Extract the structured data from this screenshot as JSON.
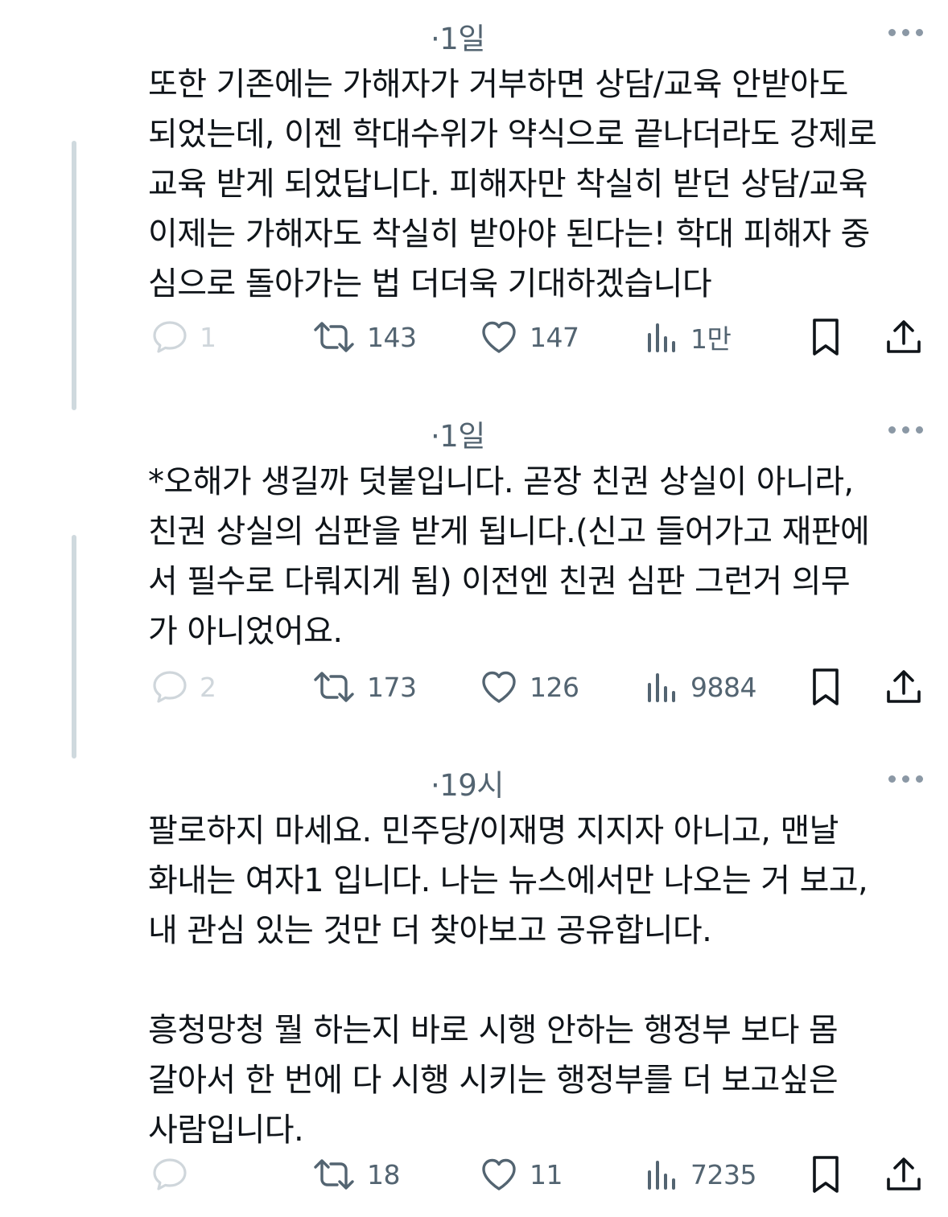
{
  "tweets": [
    {
      "time": "·1일",
      "text": "또한 기존에는 가해자가 거부하면 상담/교육 안받아도\n되었는데, 이젠 학대수위가 약식으로 끝나더라도 강제로\n교육 받게 되었답니다. 피해자만 착실히 받던 상담/교육\n이제는 가해자도 착실히 받아야 된다는! 학대 피해자 중\n심으로 돌아가는 법 더더욱 기대하겠습니다",
      "replies": "1",
      "retweets": "143",
      "likes": "147",
      "views": "1만"
    },
    {
      "time": "·1일",
      "text": "*오해가 생길까 덧붙입니다. 곧장 친권 상실이 아니라,\n친권 상실의 심판을 받게 됩니다.(신고 들어가고 재판에\n서 필수로 다뤄지게 됨) 이전엔 친권 심판 그런거 의무\n가 아니었어요.",
      "replies": "2",
      "retweets": "173",
      "likes": "126",
      "views": "9884"
    },
    {
      "time": "·19시",
      "text": "팔로하지 마세요. 민주당/이재명 지지자 아니고, 맨날\n화내는 여자1 입니다. 나는 뉴스에서만 나오는 거 보고,\n내 관심 있는 것만 더 찾아보고 공유합니다.\n\n흥청망청 뭘 하는지 바로 시행 안하는 행정부 보다 몸\n갈아서 한 번에 다 시행 시키는 행정부를 더 보고싶은\n사람입니다.",
      "replies": "",
      "retweets": "18",
      "likes": "11",
      "views": "7235"
    }
  ],
  "icons": {
    "reply": "reply-icon",
    "retweet": "retweet-icon",
    "like": "like-icon",
    "views": "views-icon",
    "bookmark": "bookmark-icon",
    "share": "share-icon",
    "more": "more-icon"
  },
  "colors": {
    "text": "#0f1419",
    "secondary": "#536471",
    "faint": "#cfd6db",
    "thread_line": "#cfd9de"
  }
}
